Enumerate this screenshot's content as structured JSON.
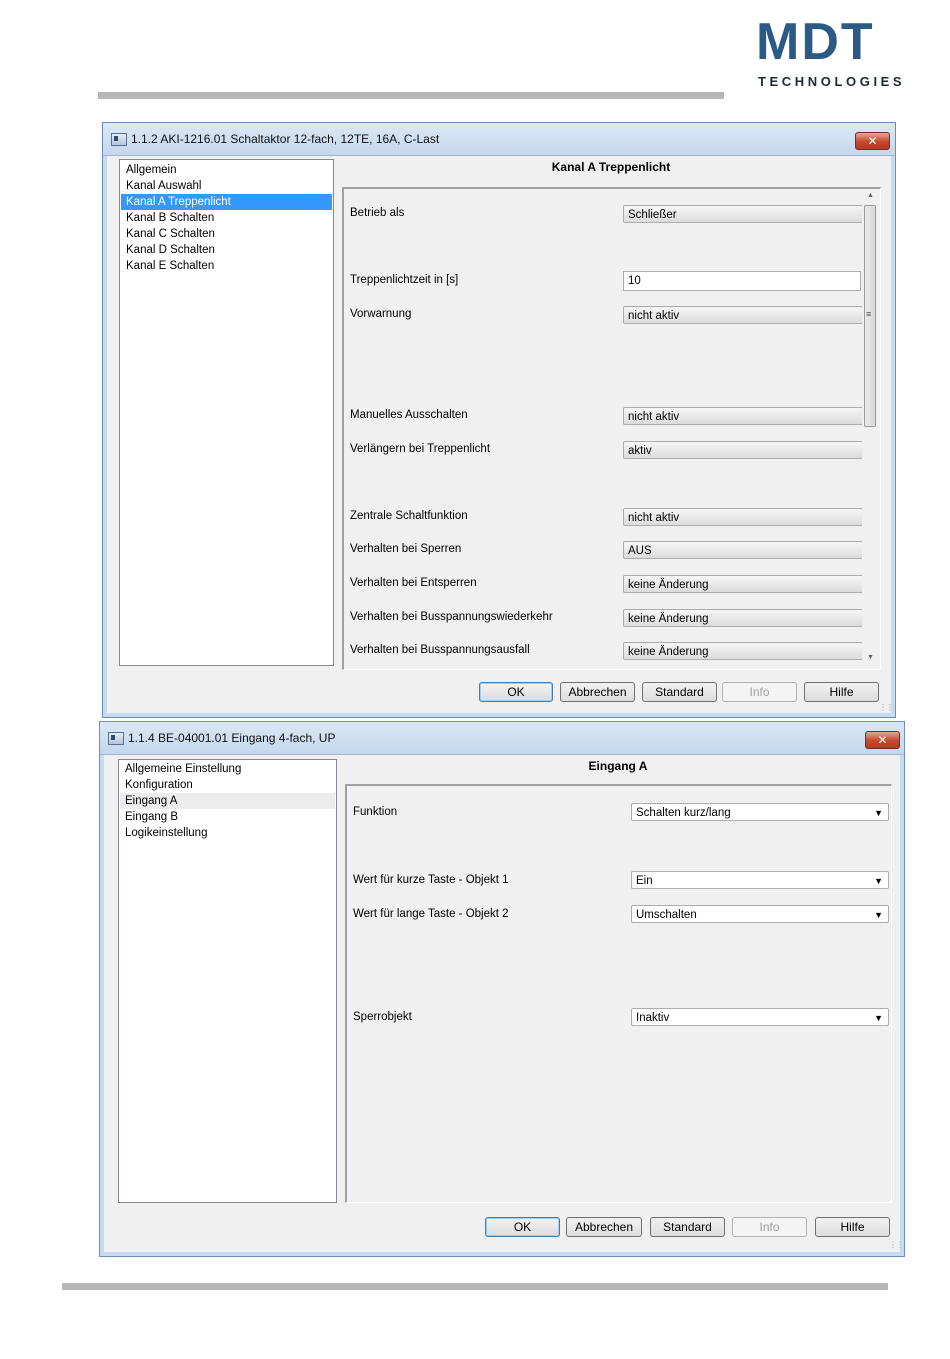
{
  "header": {
    "logo_mark": "MDT",
    "logo_sub": "TECHNOLOGIES"
  },
  "window1": {
    "title": "1.1.2 AKI-1216.01 Schaltaktor 12-fach, 12TE, 16A, C-Last",
    "nav": [
      "Allgemein",
      "Kanal Auswahl",
      "Kanal A Treppenlicht",
      "Kanal B Schalten",
      "Kanal C Schalten",
      "Kanal D Schalten",
      "Kanal E Schalten"
    ],
    "selected_nav": "Kanal A Treppenlicht",
    "panel_title": "Kanal A Treppenlicht",
    "params": {
      "betrieb_label": "Betrieb als",
      "betrieb_value": "Schließer",
      "zeit_label": "Treppenlichtzeit in [s]",
      "zeit_value": "10",
      "vorwarnung_label": "Vorwarnung",
      "vorwarnung_value": "nicht aktiv",
      "manuell_label": "Manuelles Ausschalten",
      "manuell_value": "nicht aktiv",
      "verlaengern_label": "Verlängern bei Treppenlicht",
      "verlaengern_value": "aktiv",
      "zentral_label": "Zentrale Schaltfunktion",
      "zentral_value": "nicht aktiv",
      "sperren_label": "Verhalten bei Sperren",
      "sperren_value": "AUS",
      "entsperren_label": "Verhalten bei Entsperren",
      "entsperren_value": "keine Änderung",
      "wiederkehr_label": "Verhalten bei Busspannungswiederkehr",
      "wiederkehr_value": "keine Änderung",
      "ausfall_label": "Verhalten bei Busspannungsausfall",
      "ausfall_value": "keine Änderung"
    },
    "buttons": {
      "ok": "OK",
      "cancel": "Abbrechen",
      "standard": "Standard",
      "info": "Info",
      "help": "Hilfe"
    }
  },
  "window2": {
    "title": "1.1.4 BE-04001.01 Eingang 4-fach, UP",
    "nav": [
      "Allgemeine Einstellung",
      "Konfiguration",
      "Eingang A",
      "Eingang B",
      "Logikeinstellung"
    ],
    "selected_nav": "Eingang A",
    "panel_title": "Eingang A",
    "params": {
      "funktion_label": "Funktion",
      "funktion_value": "Schalten kurz/lang",
      "kurz_label": "Wert für kurze Taste - Objekt 1",
      "kurz_value": "Ein",
      "lang_label": "Wert für lange Taste - Objekt 2",
      "lang_value": "Umschalten",
      "sperr_label": "Sperrobjekt",
      "sperr_value": "Inaktiv"
    },
    "buttons": {
      "ok": "OK",
      "cancel": "Abbrechen",
      "standard": "Standard",
      "info": "Info",
      "help": "Hilfe"
    }
  }
}
